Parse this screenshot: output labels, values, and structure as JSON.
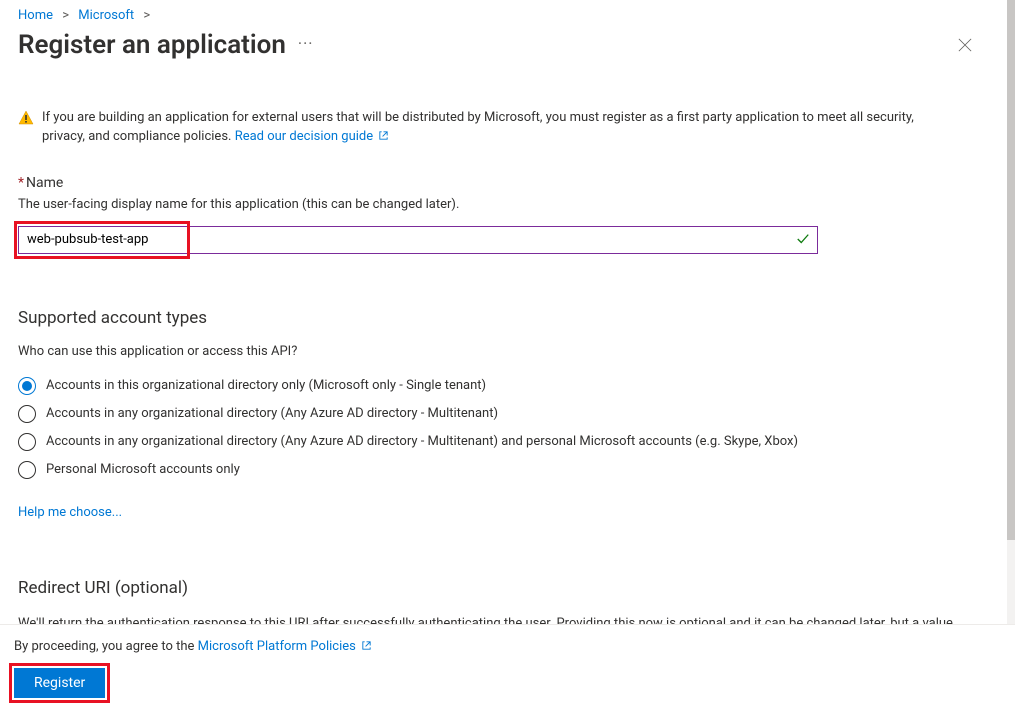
{
  "breadcrumb": {
    "items": [
      "Home",
      "Microsoft"
    ]
  },
  "title": "Register an application",
  "warning": {
    "text": "If you are building an application for external users that will be distributed by Microsoft, you must register as a first party application to meet all security, privacy, and compliance policies.",
    "link": "Read our decision guide"
  },
  "name": {
    "label": "Name",
    "help": "The user-facing display name for this application (this can be changed later).",
    "value": "web-pubsub-test-app"
  },
  "accountTypes": {
    "heading": "Supported account types",
    "sub": "Who can use this application or access this API?",
    "options": [
      "Accounts in this organizational directory only (Microsoft only - Single tenant)",
      "Accounts in any organizational directory (Any Azure AD directory - Multitenant)",
      "Accounts in any organizational directory (Any Azure AD directory - Multitenant) and personal Microsoft accounts (e.g. Skype, Xbox)",
      "Personal Microsoft accounts only"
    ],
    "selected": 0,
    "helpLink": "Help me choose..."
  },
  "redirect": {
    "heading": "Redirect URI (optional)",
    "desc": "We'll return the authentication response to this URI after successfully authenticating the user. Providing this now is optional and it can be changed later, but a value is required for most authentication scenarios."
  },
  "footer": {
    "agreePrefix": "By proceeding, you agree to the ",
    "agreeLink": "Microsoft Platform Policies",
    "register": "Register"
  }
}
